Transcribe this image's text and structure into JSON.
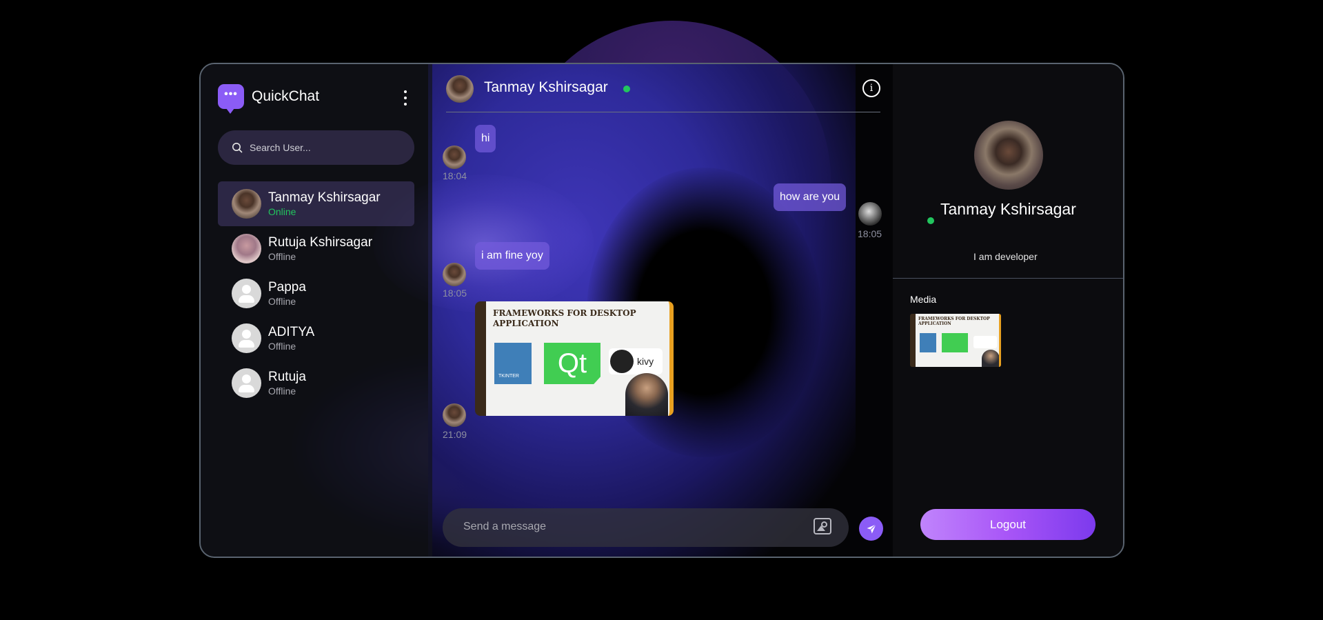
{
  "app": {
    "name": "QuickChat",
    "logo_glyph": "•••"
  },
  "search": {
    "placeholder": "Search User..."
  },
  "users": [
    {
      "name": "Tanmay Kshirsagar",
      "status": "Online",
      "active": true
    },
    {
      "name": "Rutuja Kshirsagar",
      "status": "Offline",
      "active": false
    },
    {
      "name": "Pappa",
      "status": "Offline",
      "active": false
    },
    {
      "name": "ADITYA",
      "status": "Offline",
      "active": false
    },
    {
      "name": "Rutuja",
      "status": "Offline",
      "active": false
    }
  ],
  "chat": {
    "header_name": "Tanmay Kshirsagar",
    "info_glyph": "i",
    "messages": [
      {
        "text": "hi",
        "time": "18:04",
        "side": "left"
      },
      {
        "text": "how are you",
        "time": "18:05",
        "side": "right"
      },
      {
        "text": "i am fine yoy",
        "time": "18:05",
        "side": "left"
      },
      {
        "type": "image",
        "time": "21:09",
        "side": "left",
        "image_title": "FRAMEWORKS FOR DESKTOP APPLICATION",
        "image_tk": "TKINTER",
        "image_qt": "Qt",
        "image_kivy": "kivy"
      }
    ],
    "composer_placeholder": "Send a message"
  },
  "profile": {
    "name": "Tanmay Kshirsagar",
    "bio": "I am developer",
    "media_label": "Media",
    "media_thumb_title": "FRAMEWORKS FOR DESKTOP APPLICATION",
    "logout_label": "Logout"
  },
  "colors": {
    "accent": "#8b5cf6",
    "online": "#22c55e",
    "bubble": "#745cdc"
  }
}
